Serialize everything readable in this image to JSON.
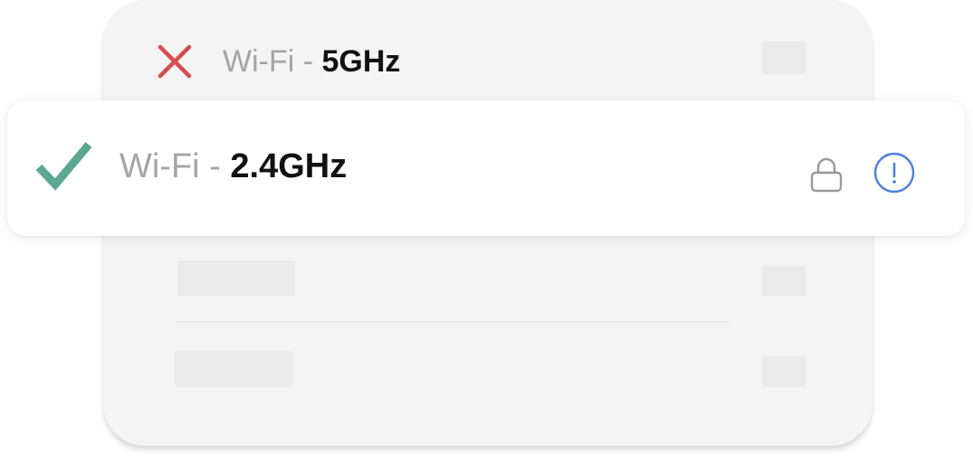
{
  "networks": [
    {
      "prefix": "Wi-Fi - ",
      "band": "5GHz",
      "status_icon": "x-icon"
    },
    {
      "prefix": "Wi-Fi - ",
      "band": "2.4GHz",
      "status_icon": "check-icon",
      "lock_icon": "lock-icon",
      "info_icon": "info-icon"
    }
  ],
  "colors": {
    "error": "#d94d4d",
    "success": "#5aa892",
    "info": "#4a7fe0",
    "muted_text": "#a5a5a5",
    "strong_text": "#111111"
  }
}
